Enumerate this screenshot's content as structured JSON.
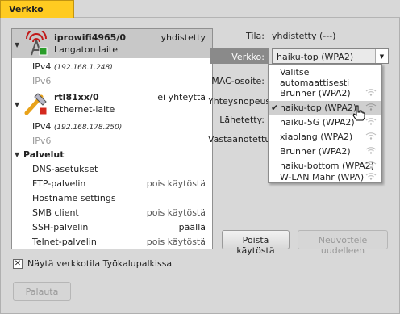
{
  "tab": {
    "title": "Verkko"
  },
  "devices": [
    {
      "name": "iprowifi4965/0",
      "type": "Langaton laite",
      "status": "yhdistetty",
      "ipv4_label": "IPv4",
      "ipv4": "(192.168.1.248)",
      "ipv6_label": "IPv6",
      "icon": "wifi-antenna-icon"
    },
    {
      "name": "rtl81xx/0",
      "type": "Ethernet-laite",
      "status": "ei yhteyttä",
      "ipv4_label": "IPv4",
      "ipv4": "(192.168.178.250)",
      "ipv6_label": "IPv6",
      "icon": "ethernet-plug-icon"
    }
  ],
  "services": {
    "header": "Palvelut",
    "items": [
      {
        "name": "DNS-asetukset",
        "status": ""
      },
      {
        "name": "FTP-palvelin",
        "status": "pois käytöstä"
      },
      {
        "name": "Hostname settings",
        "status": ""
      },
      {
        "name": "SMB client",
        "status": "pois käytöstä"
      },
      {
        "name": "SSH-palvelin",
        "status": "päällä"
      },
      {
        "name": "Telnet-palvelin",
        "status": "pois käytöstä"
      }
    ]
  },
  "details": {
    "tila_label": "Tila:",
    "tila_value": "yhdistetty (---)",
    "verkko_label": "Verkko:",
    "verkko_value": "haiku-top (WPA2)",
    "mac_label": "MAC-osoite:",
    "speed_label": "Yhteysnopeus:",
    "sent_label": "Lähetetty:",
    "received_label": "Vastaanotettu:"
  },
  "network_menu": {
    "auto_label": "Valitse automaattisesti",
    "selected_index": 1,
    "items": [
      "Brunner (WPA2)",
      "haiku-top (WPA2)",
      "haiku-5G (WPA2)",
      "xiaolang (WPA2)",
      "Brunner (WPA2)",
      "haiku-bottom (WPA2)",
      "W-LAN Mahr (WPA)"
    ]
  },
  "buttons": {
    "disable": "Poista käytöstä",
    "renegotiate": "Neuvottele uudelleen",
    "revert": "Palauta"
  },
  "show_in_deskbar": {
    "label": "Näytä verkkotila Työkalupalkissa",
    "checked": true
  },
  "colors": {
    "tab": "#ffcb21",
    "selection": "#c8c8c8",
    "connected_led": "#2a9d2a",
    "disconnected_led": "#d42a1e"
  }
}
